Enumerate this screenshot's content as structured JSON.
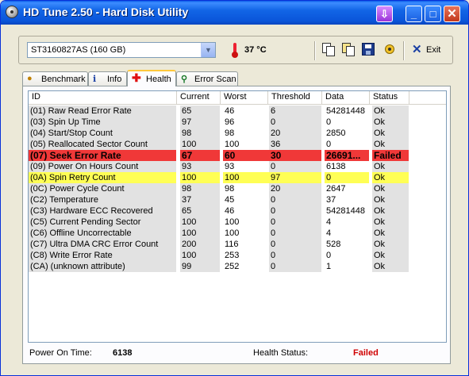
{
  "window": {
    "title": "HD Tune 2.50 - Hard Disk Utility"
  },
  "toolbar": {
    "drive": "ST3160827AS (160 GB)",
    "temperature": "37 °C",
    "exit_label": "Exit"
  },
  "tabs": [
    {
      "label": "Benchmark"
    },
    {
      "label": "Info"
    },
    {
      "label": "Health",
      "active": true
    },
    {
      "label": "Error Scan"
    }
  ],
  "table": {
    "columns": [
      "ID",
      "Current",
      "Worst",
      "Threshold",
      "Data",
      "Status"
    ],
    "rows": [
      {
        "id": "(01) Raw Read Error Rate",
        "current": "65",
        "worst": "46",
        "threshold": "6",
        "data": "54281448",
        "status": "Ok"
      },
      {
        "id": "(03) Spin Up Time",
        "current": "97",
        "worst": "96",
        "threshold": "0",
        "data": "0",
        "status": "Ok"
      },
      {
        "id": "(04) Start/Stop Count",
        "current": "98",
        "worst": "98",
        "threshold": "20",
        "data": "2850",
        "status": "Ok"
      },
      {
        "id": "(05) Reallocated Sector Count",
        "current": "100",
        "worst": "100",
        "threshold": "36",
        "data": "0",
        "status": "Ok"
      },
      {
        "id": "(07) Seek Error Rate",
        "current": "67",
        "worst": "60",
        "threshold": "30",
        "data": "26691...",
        "status": "Failed",
        "highlight": "fail"
      },
      {
        "id": "(09) Power On Hours Count",
        "current": "93",
        "worst": "93",
        "threshold": "0",
        "data": "6138",
        "status": "Ok"
      },
      {
        "id": "(0A) Spin Retry Count",
        "current": "100",
        "worst": "100",
        "threshold": "97",
        "data": "0",
        "status": "Ok",
        "highlight": "warn"
      },
      {
        "id": "(0C) Power Cycle Count",
        "current": "98",
        "worst": "98",
        "threshold": "20",
        "data": "2647",
        "status": "Ok"
      },
      {
        "id": "(C2) Temperature",
        "current": "37",
        "worst": "45",
        "threshold": "0",
        "data": "37",
        "status": "Ok"
      },
      {
        "id": "(C3) Hardware ECC Recovered",
        "current": "65",
        "worst": "46",
        "threshold": "0",
        "data": "54281448",
        "status": "Ok"
      },
      {
        "id": "(C5) Current Pending Sector",
        "current": "100",
        "worst": "100",
        "threshold": "0",
        "data": "4",
        "status": "Ok"
      },
      {
        "id": "(C6) Offline Uncorrectable",
        "current": "100",
        "worst": "100",
        "threshold": "0",
        "data": "4",
        "status": "Ok"
      },
      {
        "id": "(C7) Ultra DMA CRC Error Count",
        "current": "200",
        "worst": "116",
        "threshold": "0",
        "data": "528",
        "status": "Ok"
      },
      {
        "id": "(C8) Write Error Rate",
        "current": "100",
        "worst": "253",
        "threshold": "0",
        "data": "0",
        "status": "Ok"
      },
      {
        "id": "(CA) (unknown attribute)",
        "current": "99",
        "worst": "252",
        "threshold": "0",
        "data": "1",
        "status": "Ok"
      }
    ]
  },
  "footer": {
    "power_on_label": "Power On Time:",
    "power_on_value": "6138",
    "health_label": "Health Status:",
    "health_value": "Failed"
  },
  "colors": {
    "fail_row": "#F03838",
    "warn_row": "#FFFF55",
    "failed_text": "#D00000"
  }
}
